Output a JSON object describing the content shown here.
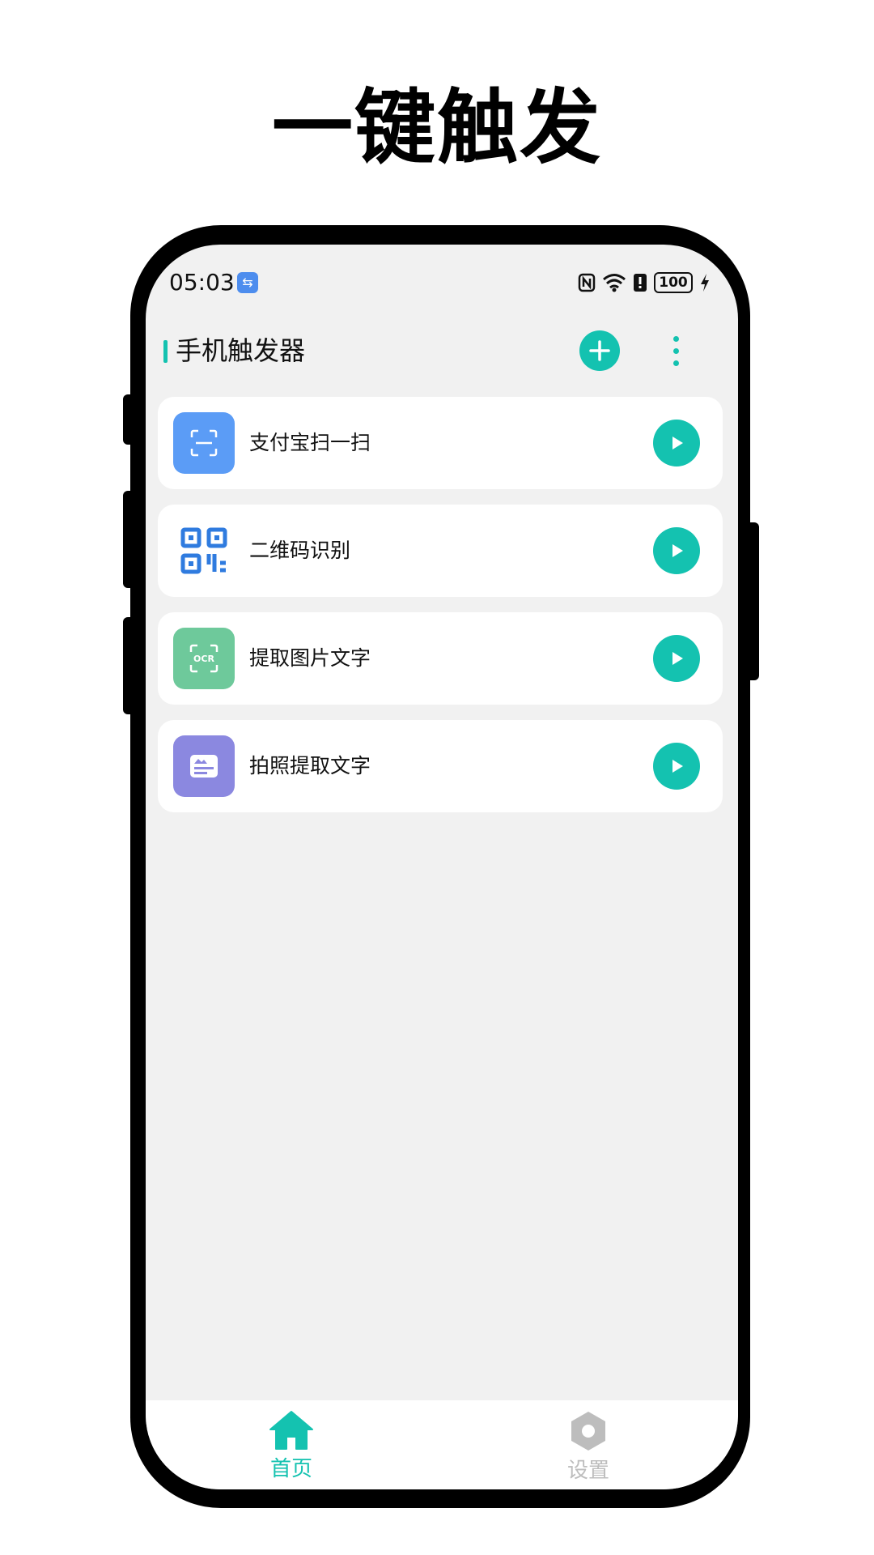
{
  "headline": "一键触发",
  "status_bar": {
    "time": "05:03",
    "battery": "100"
  },
  "app_bar": {
    "title": "手机触发器"
  },
  "shortcuts": [
    {
      "label": "支付宝扫一扫",
      "icon": "scan-icon",
      "icon_color": "#5b9cf6"
    },
    {
      "label": "二维码识别",
      "icon": "qr-code-icon",
      "icon_color": "#2f7bdf"
    },
    {
      "label": "提取图片文字",
      "icon": "ocr-icon",
      "icon_color": "#6ec99b",
      "icon_text": "OCR"
    },
    {
      "label": "拍照提取文字",
      "icon": "photo-card-icon",
      "icon_color": "#8b88e0"
    }
  ],
  "bottom_nav": [
    {
      "label": "首页",
      "icon": "home-icon",
      "active": true
    },
    {
      "label": "设置",
      "icon": "settings-hex-icon",
      "active": false
    }
  ],
  "colors": {
    "accent": "#14c2b0",
    "inactive": "#bdbdbd",
    "background": "#f1f1f1"
  }
}
